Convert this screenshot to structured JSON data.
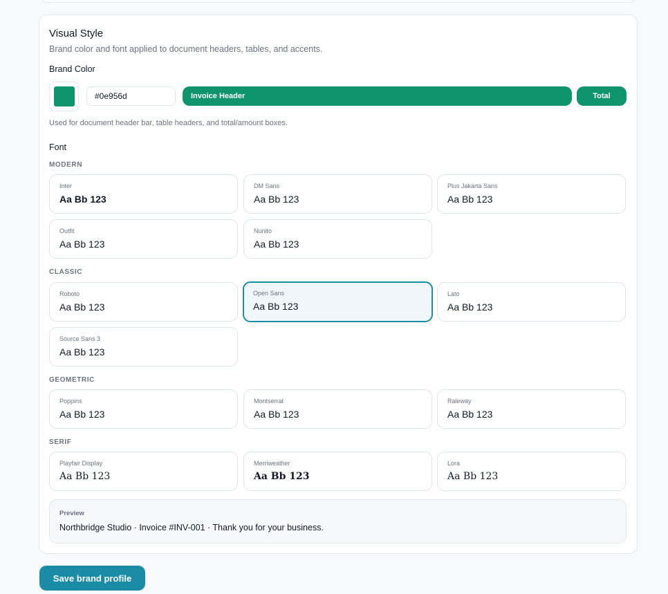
{
  "section": {
    "title": "Visual Style",
    "subtitle": "Brand color and font applied to document headers, tables, and accents."
  },
  "brand_color": {
    "label": "Brand Color",
    "value": "#0e956d",
    "header_preview_label": "Invoice Header",
    "total_preview_label": "Total",
    "hint": "Used for document header bar, table headers, and total/amount boxes."
  },
  "font": {
    "label": "Font",
    "selected": "Open Sans",
    "categories": [
      {
        "name": "MODERN",
        "fonts": [
          {
            "name": "Inter",
            "sample": "Aa Bb 123"
          },
          {
            "name": "DM Sans",
            "sample": "Aa Bb 123"
          },
          {
            "name": "Plus Jakarta Sans",
            "sample": "Aa Bb 123"
          },
          {
            "name": "Outfit",
            "sample": "Aa Bb 123"
          },
          {
            "name": "Nunito",
            "sample": "Aa Bb 123"
          }
        ]
      },
      {
        "name": "CLASSIC",
        "fonts": [
          {
            "name": "Roboto",
            "sample": "Aa Bb 123"
          },
          {
            "name": "Open Sans",
            "sample": "Aa Bb 123"
          },
          {
            "name": "Lato",
            "sample": "Aa Bb 123"
          },
          {
            "name": "Source Sans 3",
            "sample": "Aa Bb 123"
          }
        ]
      },
      {
        "name": "GEOMETRIC",
        "fonts": [
          {
            "name": "Poppins",
            "sample": "Aa Bb 123"
          },
          {
            "name": "Montserrat",
            "sample": "Aa Bb 123"
          },
          {
            "name": "Raleway",
            "sample": "Aa Bb 123"
          }
        ]
      },
      {
        "name": "SERIF",
        "fonts": [
          {
            "name": "Playfair Display",
            "sample": "Aa Bb 123"
          },
          {
            "name": "Merriweather",
            "sample": "Aa Bb 123"
          },
          {
            "name": "Lora",
            "sample": "Aa Bb 123"
          }
        ]
      }
    ]
  },
  "preview": {
    "label": "Preview",
    "text": "Northbridge Studio · Invoice #INV-001 · Thank you for your business."
  },
  "actions": {
    "save_label": "Save brand profile"
  },
  "colors": {
    "brand": "#0e956d",
    "primary_button": "#1a8ca5",
    "selected_border": "#1a8ca5"
  }
}
